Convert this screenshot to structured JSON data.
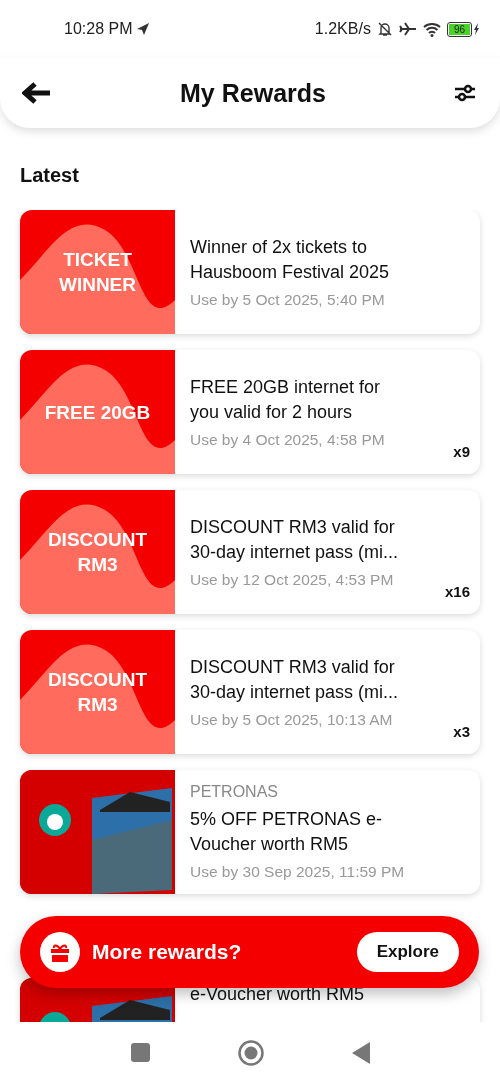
{
  "status_bar": {
    "time": "10:28 PM",
    "speed": "1.2KB/s",
    "battery": "96"
  },
  "header": {
    "title": "My Rewards"
  },
  "section": {
    "title": "Latest"
  },
  "rewards": [
    {
      "kind": "graphic",
      "thumb_text": "TICKET WINNER",
      "title": "Winner of 2x tickets to Hausboom Festival 2025",
      "expiry": "Use by 5 Oct 2025, 5:40 PM"
    },
    {
      "kind": "graphic",
      "thumb_text": "FREE 20GB",
      "title": "FREE 20GB internet for you valid for 2 hours",
      "expiry": "Use by 4 Oct 2025, 4:58 PM",
      "count": "x9"
    },
    {
      "kind": "graphic",
      "thumb_text": "DISCOUNT RM3",
      "title": "DISCOUNT RM3 valid for 30-day internet pass (mi...",
      "expiry": "Use by 12 Oct 2025, 4:53 PM",
      "count": "x16"
    },
    {
      "kind": "graphic",
      "thumb_text": "DISCOUNT RM3",
      "title": "DISCOUNT RM3 valid for 30-day internet pass (mi...",
      "expiry": "Use by 5 Oct 2025, 10:13 AM",
      "count": "x3"
    },
    {
      "kind": "image",
      "brand": "PETRONAS",
      "title": "5% OFF PETRONAS e-Voucher worth RM5",
      "expiry": "Use by 30 Sep 2025, 11:59 PM"
    },
    {
      "kind": "image",
      "title": "e-Voucher worth RM5"
    }
  ],
  "banner": {
    "text": "More rewards?",
    "button": "Explore"
  }
}
